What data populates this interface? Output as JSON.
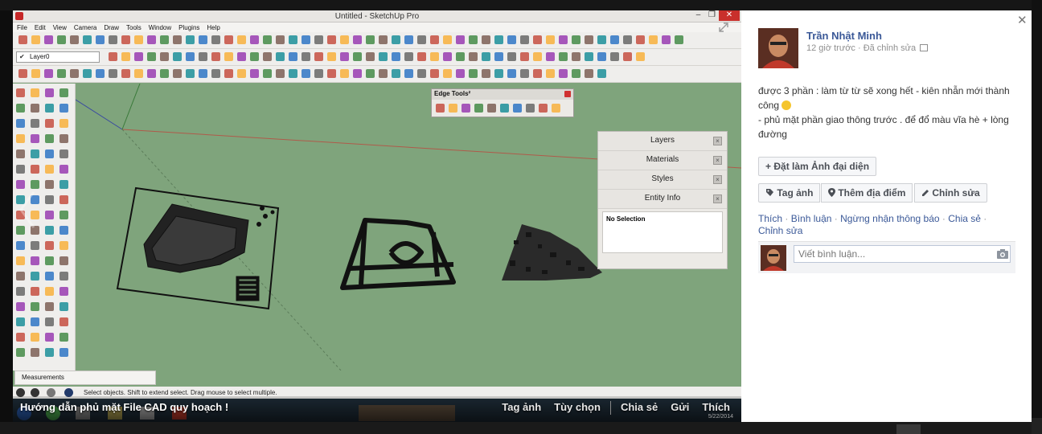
{
  "photo": {
    "window_title": "Untitled - SketchUp Pro",
    "menu": [
      "File",
      "Edit",
      "View",
      "Camera",
      "Draw",
      "Tools",
      "Window",
      "Plugins",
      "Help"
    ],
    "layer_value": "Layer0",
    "edge_tools_title": "Edge Tools²",
    "tray_panels": [
      "Layers",
      "Materials",
      "Styles",
      "Entity Info"
    ],
    "entity_info_text": "No Selection",
    "measurements_label": "Measurements",
    "status_text": "Select objects. Shift to extend select. Drag mouse to select multiple.",
    "caption": "Hướng dẫn phủ mặt File CAD quy hoạch !",
    "caption_actions": [
      "Tag ảnh",
      "Tùy chọn",
      "Chia sẻ",
      "Gửi",
      "Thích"
    ],
    "taskbar_date": "5/22/2014",
    "colors": {
      "viewport": "#7fa47c",
      "accent": "#3b5998"
    }
  },
  "sidebar": {
    "author": "Trần Nhật Minh",
    "meta": "12 giờ trước · Đã chỉnh sửa",
    "post_line1": "được 3 phần : làm từ từ sẽ xong hết - kiên nhẫn mới thành công",
    "post_line2": "- phủ mặt phần giao thông trước . để đổ màu vĩa hè + lòng đường",
    "btn_profile": "Đặt làm Ảnh đại diện",
    "btn_tag": "Tag ảnh",
    "btn_place": "Thêm địa điểm",
    "btn_edit": "Chỉnh sửa",
    "actions": [
      "Thích",
      "Bình luận",
      "Ngừng nhận thông báo",
      "Chia sẻ",
      "Chỉnh sửa"
    ],
    "comment_placeholder": "Viết bình luận...",
    "icons": [
      "close-icon",
      "plus-icon",
      "tag-icon",
      "pin-icon",
      "pencil-icon",
      "camera-icon",
      "emoji-icon"
    ]
  }
}
